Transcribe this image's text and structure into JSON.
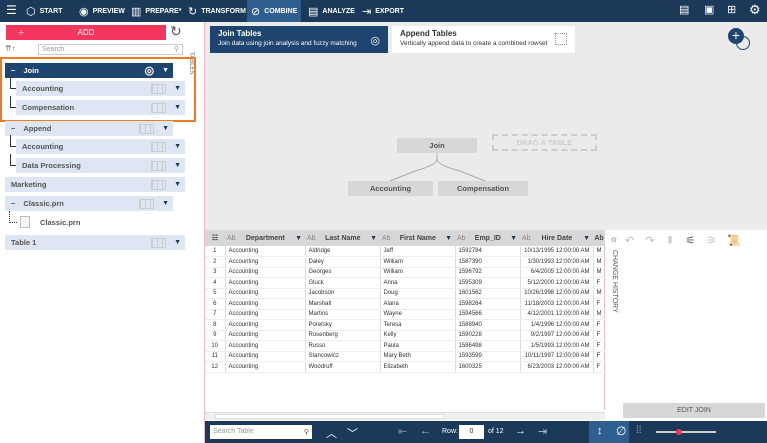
{
  "toolbar": {
    "items": [
      {
        "label": "START",
        "icon": "cube-icon",
        "glyph": "⬡"
      },
      {
        "label": "PREVIEW",
        "icon": "eye-icon",
        "glyph": "◉"
      },
      {
        "label": "PREPARE*",
        "icon": "columns-icon",
        "glyph": "▥"
      },
      {
        "label": "TRANSFORM",
        "icon": "transform-icon",
        "glyph": "↻"
      },
      {
        "label": "COMBINE",
        "icon": "combine-icon",
        "glyph": "⊘"
      },
      {
        "label": "ANALYZE",
        "icon": "clipboard-icon",
        "glyph": "▤"
      },
      {
        "label": "EXPORT",
        "icon": "export-icon",
        "glyph": "⇥"
      }
    ],
    "active": "COMBINE"
  },
  "left": {
    "add_label": "ADD",
    "search_placeholder": "Search",
    "tables_label": "TABLES",
    "tree": [
      {
        "label": "Join",
        "level": 0,
        "dark": true,
        "collapse": true
      },
      {
        "label": "Accounting",
        "level": 1
      },
      {
        "label": "Compensation",
        "level": 1
      },
      {
        "label": "Append",
        "level": 0,
        "collapse": true
      },
      {
        "label": "Accounting",
        "level": 1
      },
      {
        "label": "Data Processing",
        "level": 1
      },
      {
        "label": "Marketing",
        "level": 0
      },
      {
        "label": "Classic.prn",
        "level": 0,
        "collapse": true
      },
      {
        "label": "Classic.prn",
        "level": 2
      },
      {
        "label": "Table 1",
        "level": 0
      }
    ]
  },
  "canvas": {
    "join_tab": {
      "title": "Join Tables",
      "desc": "Join data using join analysis and fuzzy matching"
    },
    "append_tab": {
      "title": "Append Tables",
      "desc": "Vertically append data to create a combined rowset"
    },
    "join_node": "Join",
    "drag_label": "DRAG A TABLE",
    "left_table": "Accounting",
    "right_table": "Compensation"
  },
  "grid": {
    "columns": [
      "Department",
      "Last Name",
      "First Name",
      "Emp_ID",
      "Hire Date",
      "Ab"
    ],
    "type_label": "Ab",
    "rows": [
      [
        "1",
        "Accounting",
        "Aldridge",
        "Jeff",
        "1592784",
        "10/13/1995 12:00:00 AM",
        "M"
      ],
      [
        "2",
        "Accounting",
        "Daley",
        "William",
        "1587390",
        "1/30/1993 12:00:00 AM",
        "M"
      ],
      [
        "3",
        "Accounting",
        "Georges",
        "William",
        "1596792",
        "6/4/2005 12:00:00 AM",
        "M"
      ],
      [
        "4",
        "Accounting",
        "Gluck",
        "Anna",
        "1595309",
        "5/12/2000 12:00:00 AM",
        "F"
      ],
      [
        "5",
        "Accounting",
        "Jacobson",
        "Doug",
        "1601562",
        "10/26/1998 12:00:00 AM",
        "M"
      ],
      [
        "6",
        "Accounting",
        "Marshall",
        "Alana",
        "1598264",
        "11/18/2003 12:00:00 AM",
        "F"
      ],
      [
        "7",
        "Accounting",
        "Martins",
        "Wayne",
        "1594566",
        "4/12/2001 12:00:00 AM",
        "M"
      ],
      [
        "8",
        "Accounting",
        "Poretsky",
        "Teresa",
        "1588940",
        "1/4/1996 12:00:00 AM",
        "F"
      ],
      [
        "9",
        "Accounting",
        "Rosenberg",
        "Kelly",
        "1590228",
        "9/2/1997 12:00:00 AM",
        "F"
      ],
      [
        "10",
        "Accounting",
        "Russo",
        "Paula",
        "1586498",
        "1/5/1993 12:00:00 AM",
        "F"
      ],
      [
        "11",
        "Accounting",
        "Stancowicz",
        "Mary Beth",
        "1593599",
        "10/11/1997 12:00:00 AM",
        "F"
      ],
      [
        "12",
        "Accounting",
        "Woodruff",
        "Elizabeth",
        "1600325",
        "6/23/2003 12:00:00 AM",
        "F"
      ]
    ]
  },
  "history": {
    "label": "CHANGE HISTORY",
    "edit_join": "EDIT JOIN"
  },
  "bottom": {
    "search_placeholder": "Search Table",
    "row_label": "Row:",
    "row_value": "0",
    "of_label": "of 12"
  }
}
